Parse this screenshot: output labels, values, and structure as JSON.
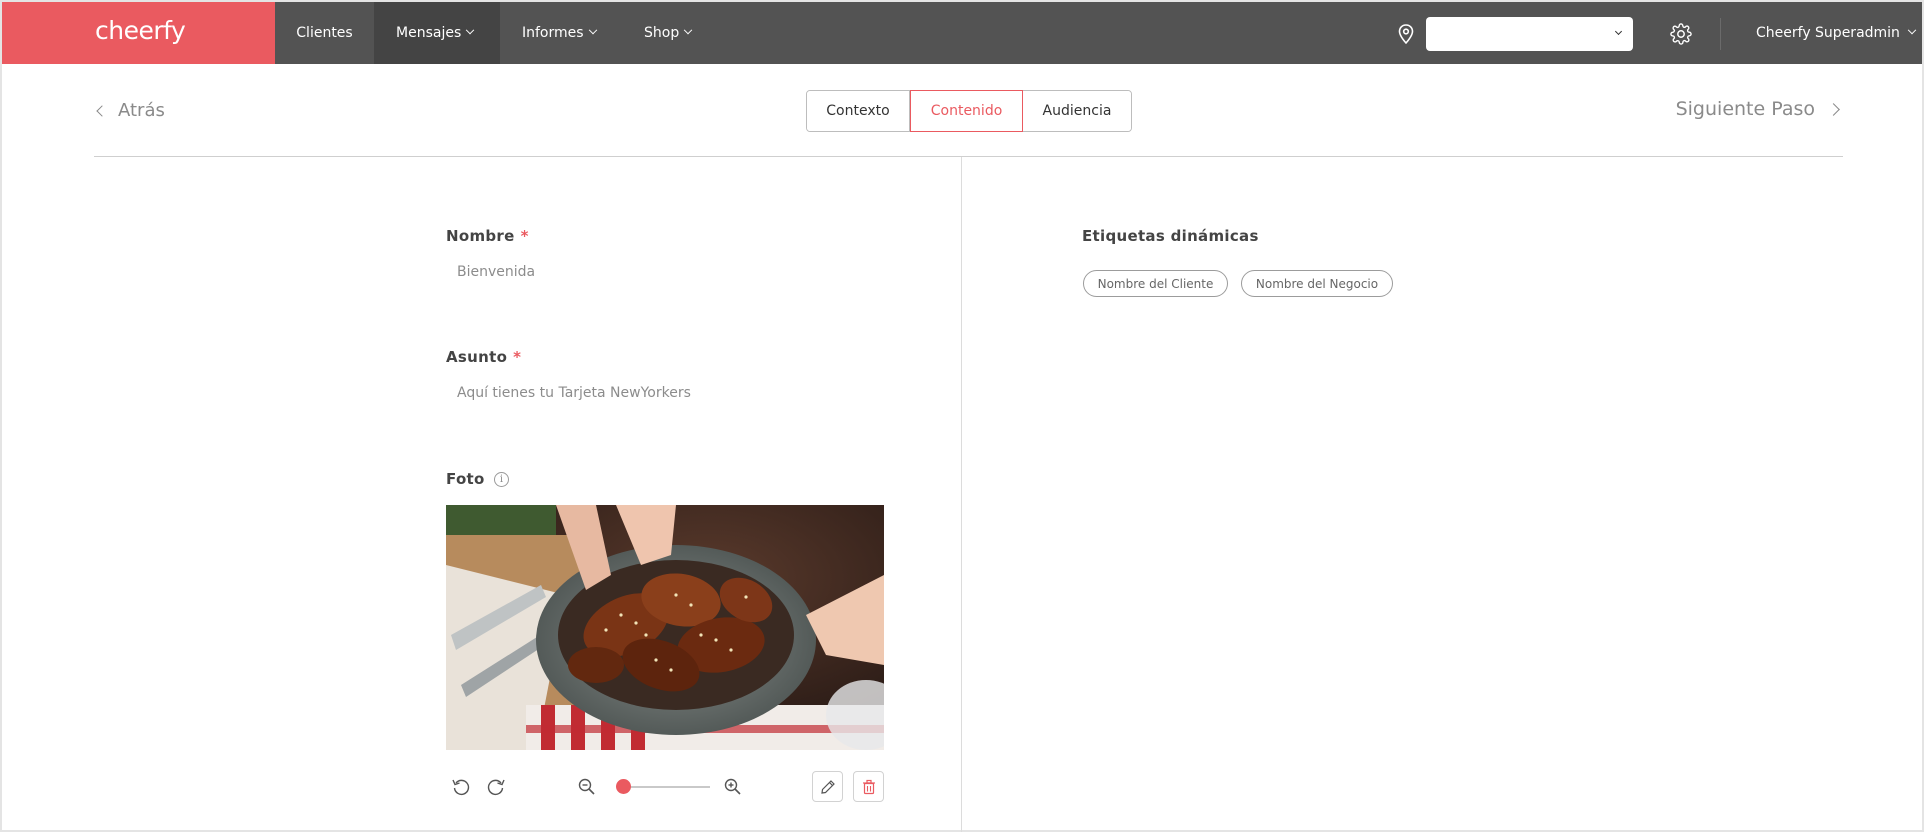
{
  "app": {
    "logo": "cheerfy"
  },
  "nav": {
    "items": [
      {
        "label": "Clientes",
        "has_chevron": false,
        "active": false
      },
      {
        "label": "Mensajes",
        "has_chevron": true,
        "active": true
      },
      {
        "label": "Informes",
        "has_chevron": true,
        "active": false
      },
      {
        "label": "Shop",
        "has_chevron": true,
        "active": false
      }
    ],
    "store_select": {
      "value": ""
    },
    "user": "Cheerfy Superadmin",
    "icons": [
      "location-pin-icon",
      "gear-icon",
      "chevron-down-icon"
    ]
  },
  "steps": {
    "back_label": "Atrás",
    "next_label": "Siguiente Paso",
    "tabs": [
      {
        "label": "Contexto",
        "active": false
      },
      {
        "label": "Contenido",
        "active": true
      },
      {
        "label": "Audiencia",
        "active": false
      }
    ]
  },
  "form": {
    "nombre": {
      "label": "Nombre",
      "required_mark": "*",
      "value": "Bienvenida"
    },
    "asunto": {
      "label": "Asunto",
      "required_mark": "*",
      "value": "Aquí tienes tu Tarjeta NewYorkers"
    },
    "foto": {
      "label": "Foto",
      "info_mark": "i",
      "image_alt": "chicken wings on a plate",
      "zoom_level": 0.05
    }
  },
  "dynamic_tags": {
    "title": "Etiquetas dinámicas",
    "chips": [
      "Nombre del Cliente",
      "Nombre del Negocio"
    ]
  },
  "colors": {
    "brand": "#ea5a60",
    "nav_bg": "#535353",
    "nav_active_bg": "#444444"
  }
}
